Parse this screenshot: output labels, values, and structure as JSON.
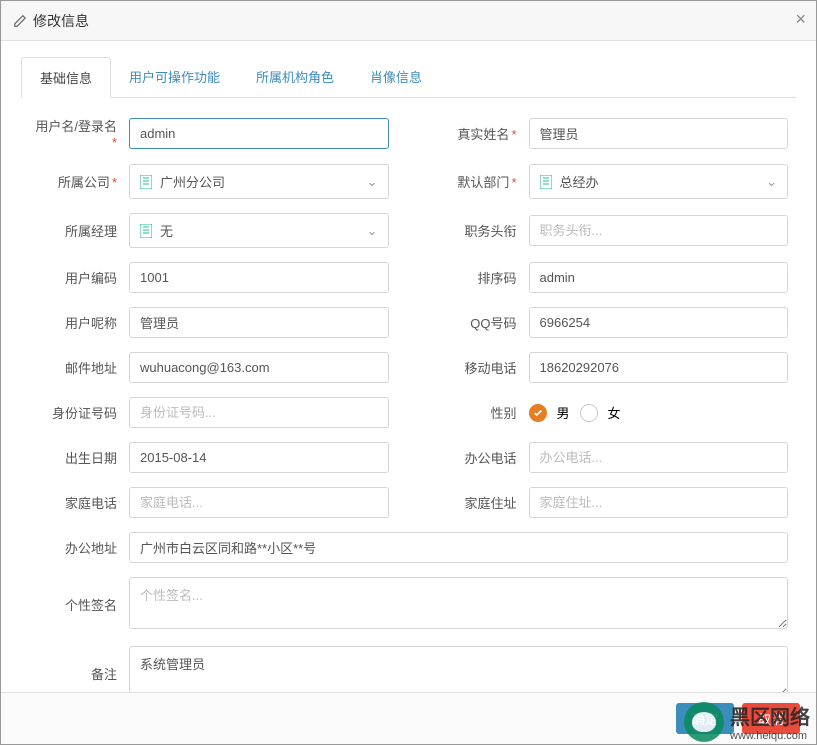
{
  "dialog": {
    "title": "修改信息"
  },
  "tabs": [
    {
      "label": "基础信息",
      "active": true
    },
    {
      "label": "用户可操作功能"
    },
    {
      "label": "所属机构角色"
    },
    {
      "label": "肖像信息"
    }
  ],
  "labels": {
    "username": "用户名/登录名",
    "realname": "真实姓名",
    "company": "所属公司",
    "dept": "默认部门",
    "manager": "所属经理",
    "title": "职务头衔",
    "usercode": "用户编码",
    "sortcode": "排序码",
    "nickname": "用户呢称",
    "qq": "QQ号码",
    "email": "邮件地址",
    "mobile": "移动电话",
    "idcard": "身份证号码",
    "gender": "性别",
    "birth": "出生日期",
    "officephone": "办公电话",
    "homephone": "家庭电话",
    "homeaddr": "家庭住址",
    "officeaddr": "办公地址",
    "signature": "个性签名",
    "remark": "备注"
  },
  "values": {
    "username": "admin",
    "realname": "管理员",
    "company": "广州分公司",
    "dept": "总经办",
    "manager": "无",
    "title": "",
    "usercode": "1001",
    "sortcode": "admin",
    "nickname": "管理员",
    "qq": "6966254",
    "email": "wuhuacong@163.com",
    "mobile": "18620292076",
    "idcard": "",
    "birth": "2015-08-14",
    "officephone": "",
    "homephone": "",
    "homeaddr": "",
    "officeaddr": "广州市白云区同和路**小区**号",
    "signature": "",
    "remark": "系统管理员"
  },
  "placeholders": {
    "title": "职务头衔...",
    "idcard": "身份证号码...",
    "officephone": "办公电话...",
    "homephone": "家庭电话...",
    "homeaddr": "家庭住址...",
    "signature": "个性签名..."
  },
  "gender": {
    "male": "男",
    "female": "女",
    "selected": "male"
  },
  "buttons": {
    "ok": "确定",
    "cancel": "取消"
  },
  "watermark": {
    "cn": "黑区网络",
    "en": "www.heiqu.com"
  }
}
